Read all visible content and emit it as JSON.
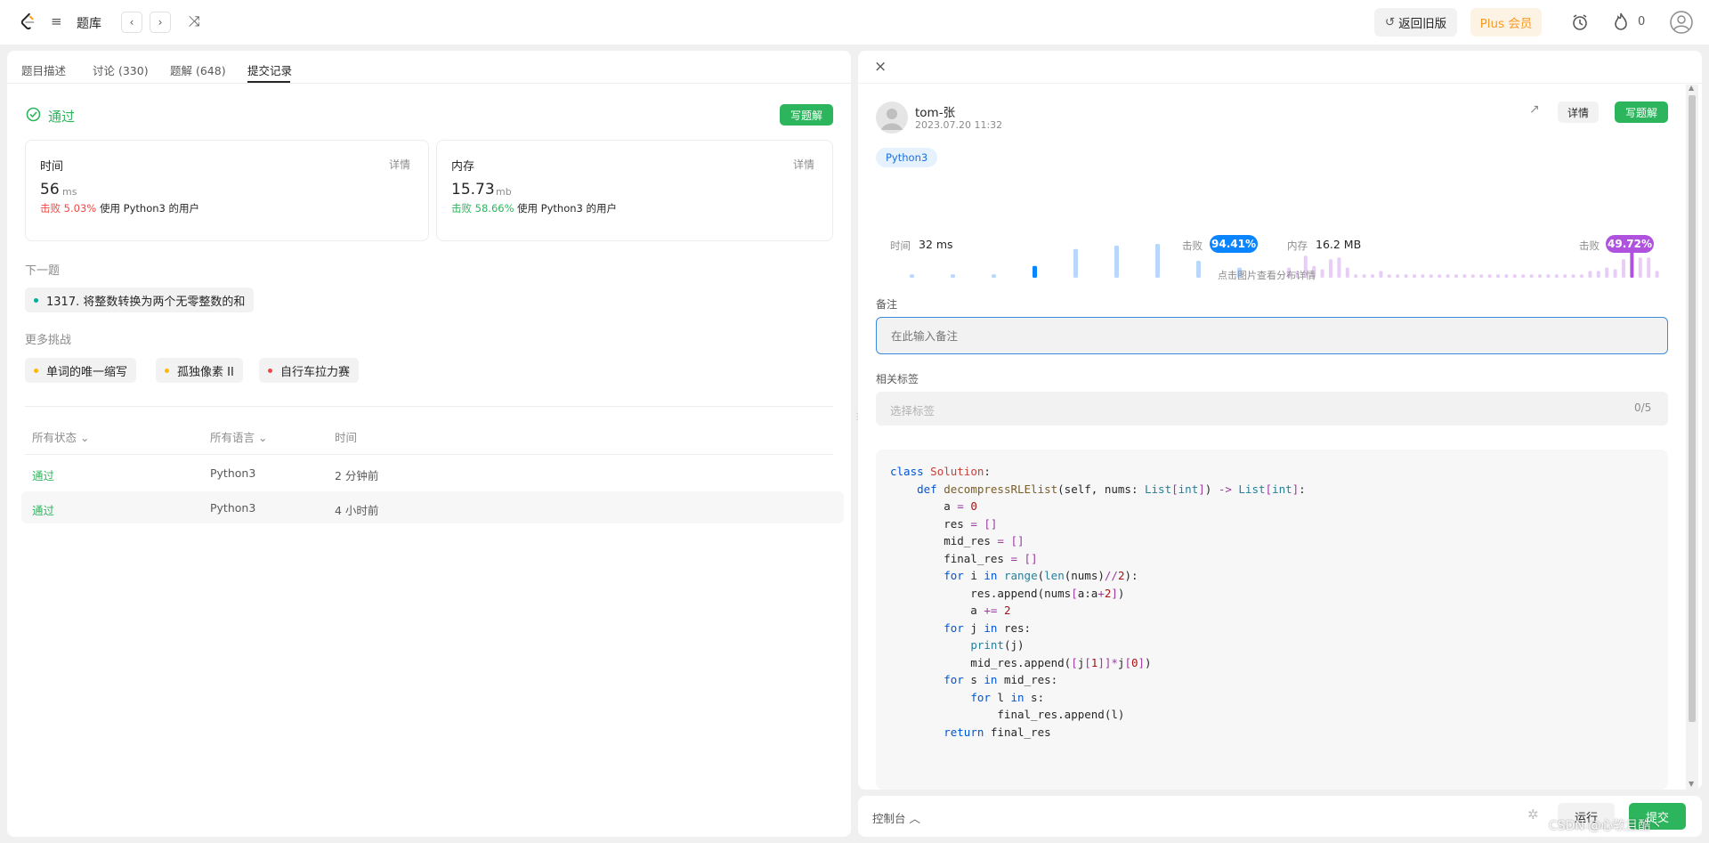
{
  "topbar": {
    "problemset_label": "题库",
    "back_old_label": "返回旧版",
    "plus_label": "Plus 会员",
    "streak_count": "0"
  },
  "left": {
    "tabs": [
      {
        "label": "题目描述"
      },
      {
        "label": "讨论 (330)"
      },
      {
        "label": "题解 (648)"
      },
      {
        "label": "提交记录"
      }
    ],
    "status": "通过",
    "write_solution": "写题解",
    "time_card": {
      "title": "时间",
      "detail": "详情",
      "value": "56",
      "unit": "ms",
      "beat": "击败 5.03%",
      "beat_suffix": "使用 Python3 的用户"
    },
    "memory_card": {
      "title": "内存",
      "detail": "详情",
      "value": "15.73",
      "unit": "mb",
      "beat": "击败 58.66%",
      "beat_suffix": "使用 Python3 的用户"
    },
    "next_label": "下一题",
    "next_problem": "1317. 将整数转换为两个无零整数的和",
    "more_label": "更多挑战",
    "challenges": [
      {
        "label": "单词的唯一缩写",
        "color": "#ffb800"
      },
      {
        "label": "孤独像素 II",
        "color": "#ffb800"
      },
      {
        "label": "自行车拉力赛",
        "color": "#ef4743"
      }
    ],
    "table": {
      "col_status": "所有状态",
      "col_lang": "所有语言",
      "col_time": "时间",
      "rows": [
        {
          "status": "通过",
          "lang": "Python3",
          "time": "2 分钟前"
        },
        {
          "status": "通过",
          "lang": "Python3",
          "time": "4 小时前"
        }
      ]
    }
  },
  "right": {
    "user": "tom-张",
    "date": "2023.07.20 11:32",
    "detail_btn": "详情",
    "write_solution": "写题解",
    "lang_tag": "Python3",
    "runtime_label": "时间",
    "runtime_value": "32 ms",
    "runtime_beat_label": "击败",
    "runtime_beat": "94.41%",
    "memory_label": "内存",
    "memory_value": "16.2 MB",
    "memory_beat_label": "击败",
    "memory_beat": "49.72%",
    "dist_hint": "点击图片查看分布详情",
    "note_label": "备注",
    "note_placeholder": "在此输入备注",
    "tags_label": "相关标签",
    "tags_placeholder": "选择标签",
    "tags_count": "0/5",
    "code_lines": [
      "class Solution:",
      "    def decompressRLElist(self, nums: List[int]) -> List[int]:",
      "        a = 0",
      "        res = []",
      "        mid_res = []",
      "        final_res = []",
      "        for i in range(len(nums)//2):",
      "            res.append(nums[a:a+2])",
      "            a += 2",
      "        for j in res:",
      "            print(j)",
      "            mid_res.append([j[1]]*j[0])",
      "        for s in mid_res:",
      "            for l in s:",
      "                final_res.append(l)",
      "        return final_res"
    ],
    "runtime_bars": [
      0.1,
      0.1,
      0.1,
      0.35,
      0.85,
      0.95,
      1.0,
      0.5,
      0.3
    ],
    "memory_bars": [
      0.3,
      0.2,
      0.65,
      0.35,
      0.25,
      0.55,
      0.6,
      0.3,
      0.1,
      0.1,
      0.1,
      0.2,
      0.1,
      0.1,
      0.1,
      0.1,
      0.1,
      0.1,
      0.1,
      0.1,
      0.1,
      0.1,
      0.1,
      0.1,
      0.1,
      0.1,
      0.1,
      0.1,
      0.1,
      0.1,
      0.1,
      0.1,
      0.1,
      0.1,
      0.1,
      0.1,
      0.2,
      0.2,
      0.3,
      0.25,
      0.55,
      1.0,
      0.6,
      0.6,
      0.2
    ]
  },
  "console": {
    "label": "控制台",
    "run": "运行",
    "submit": "提交",
    "watermark": "CSDN @心软且酷丶"
  },
  "colors": {
    "accent_green": "#2db55d",
    "runtime_blue": "#0a84ff",
    "memory_purple": "#af52de"
  }
}
